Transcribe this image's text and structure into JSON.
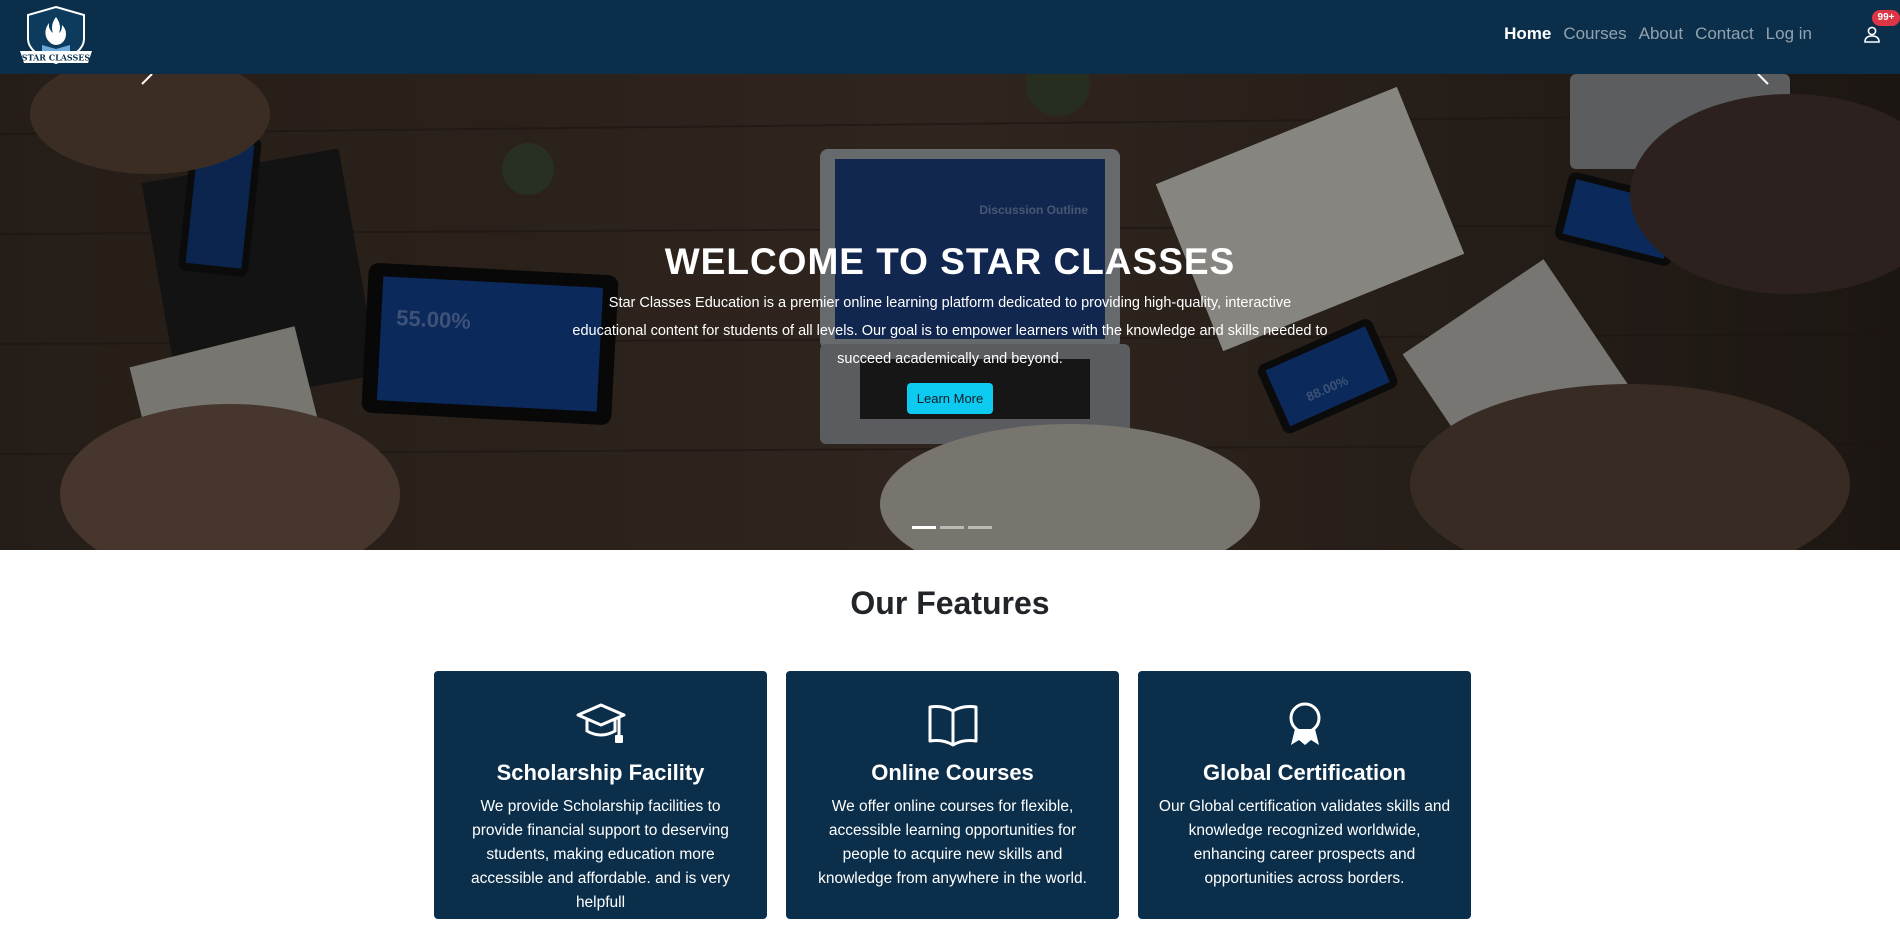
{
  "brand": {
    "logo_text": "STAR CLASSES"
  },
  "nav": {
    "links": [
      "Home",
      "Courses",
      "About",
      "Contact",
      "Log in"
    ],
    "notification_count": "99+"
  },
  "hero": {
    "title": "WELCOME TO STAR CLASSES",
    "text": "Star Classes Education is a premier online learning platform dedicated to providing high-quality, interactive educational content for students of all levels. Our goal is to empower learners with the knowledge and skills needed to succeed academically and beyond.",
    "button_label": "Learn More",
    "slides": 3,
    "active_slide": 1,
    "photo_text": {
      "tablet_stat": "55.00%",
      "screen_heading": "Discussion Outline",
      "phone_stat": "88.00%"
    }
  },
  "features": {
    "heading": "Our Features",
    "cards": [
      {
        "icon": "graduation-cap-icon",
        "title": "Scholarship Facility",
        "text": "We provide Scholarship facilities to provide financial support to deserving students, making education more accessible and affordable. and is very helpfull"
      },
      {
        "icon": "open-book-icon",
        "title": "Online Courses",
        "text": "We offer online courses for flexible, accessible learning opportunities for people to acquire new skills and knowledge from anywhere in the world."
      },
      {
        "icon": "award-icon",
        "title": "Global Certification",
        "text": "Our Global certification validates skills and knowledge recognized worldwide, enhancing career prospects and opportunities across borders."
      }
    ]
  },
  "colors": {
    "navbar": "#0b2f4b",
    "card_bg": "#0b2f4b",
    "accent_button": "#0dcaf0",
    "badge": "#dc3545"
  }
}
